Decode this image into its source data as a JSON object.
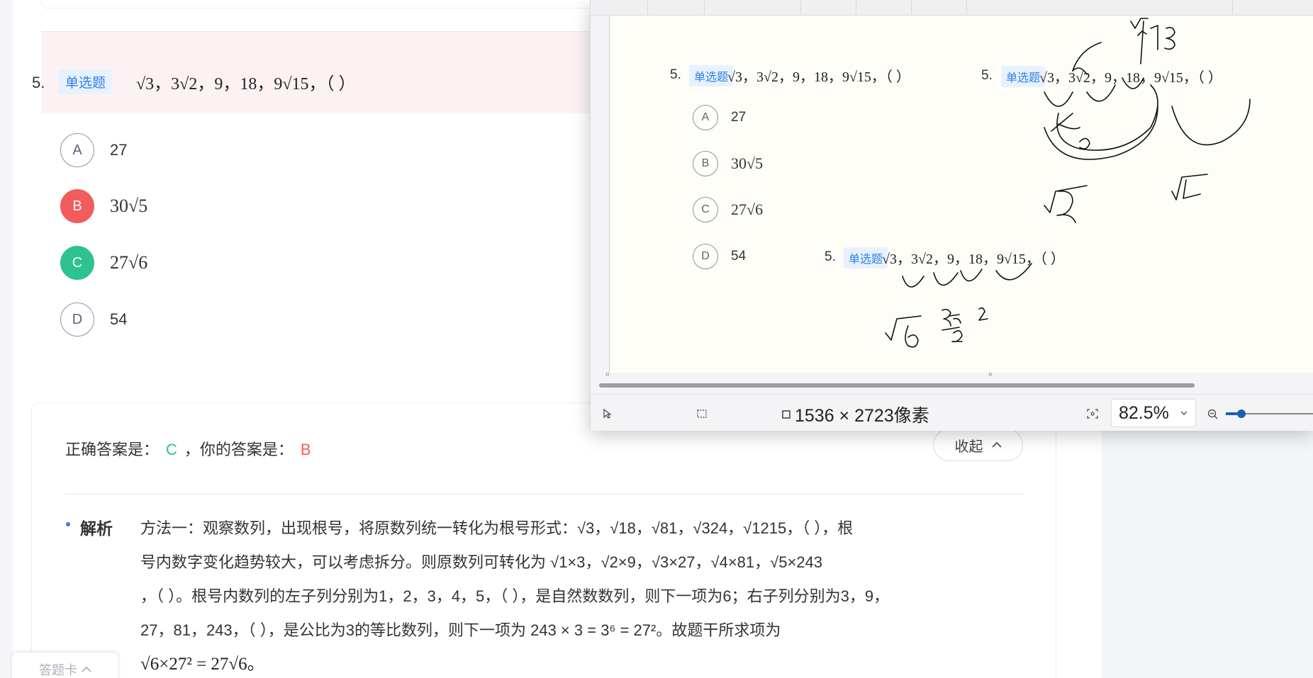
{
  "question": {
    "number": "5.",
    "type_tag": "单选题",
    "stem": "√3，3√2，9，18，9√15，（ ）",
    "options": [
      {
        "letter": "A",
        "value": "27",
        "state": "normal"
      },
      {
        "letter": "B",
        "value": "30√5",
        "state": "wrong"
      },
      {
        "letter": "C",
        "value": "27√6",
        "state": "correct"
      },
      {
        "letter": "D",
        "value": "54",
        "state": "normal"
      }
    ]
  },
  "answer": {
    "correct_label": "正确答案是：",
    "correct_value": "C",
    "separator": "，你的答案是：",
    "user_value": "B",
    "collapse_label": "收起"
  },
  "analysis": {
    "label": "解析",
    "line1": "方法一：观察数列，出现根号，将原数列统一转化为根号形式：√3，√18，√81，√324，√1215，（ ），根",
    "line2": "号内数字变化趋势较大，可以考虑拆分。则原数列可转化为 √1×3，√2×9，√3×27，√4×81，√5×243",
    "line3": "，（ ）。根号内数列的左子列分别为1，2，3，4，5，（ ），是自然数数列，则下一项为6；右子列分别为3，9，",
    "line4": "27，81，243，（ ），是公比为3的等比数列，则下一项为 243 × 3 = 3⁶ = 27²。故题干所求项为",
    "line5": "√6×27² = 27√6。"
  },
  "answer_card_label": "答题卡",
  "viewer": {
    "dimensions": "1536 × 2723像素",
    "zoom": "82.5%",
    "snippet_q1": {
      "number": "5.",
      "tag": "单选题",
      "stem": "√3，3√2，9，18，9√15，（ ）"
    },
    "snippet_q2": {
      "number": "5.",
      "tag": "单选题",
      "stem": "√3，3√2，9，18，9√15，（ ）"
    },
    "snippet_q3": {
      "number": "5.",
      "tag": "单选题",
      "stem": "√3，3√2，9，18，9√15，（ ）"
    },
    "snippet_options": [
      {
        "letter": "A",
        "value": "27"
      },
      {
        "letter": "B",
        "value": "30√5"
      },
      {
        "letter": "C",
        "value": "27√6"
      },
      {
        "letter": "D",
        "value": "54"
      }
    ]
  },
  "colors": {
    "accent_blue": "#2f7fe8",
    "correct_green": "#2dc28f",
    "wrong_red": "#f25c5c",
    "question_band": "#fdf2f3"
  }
}
